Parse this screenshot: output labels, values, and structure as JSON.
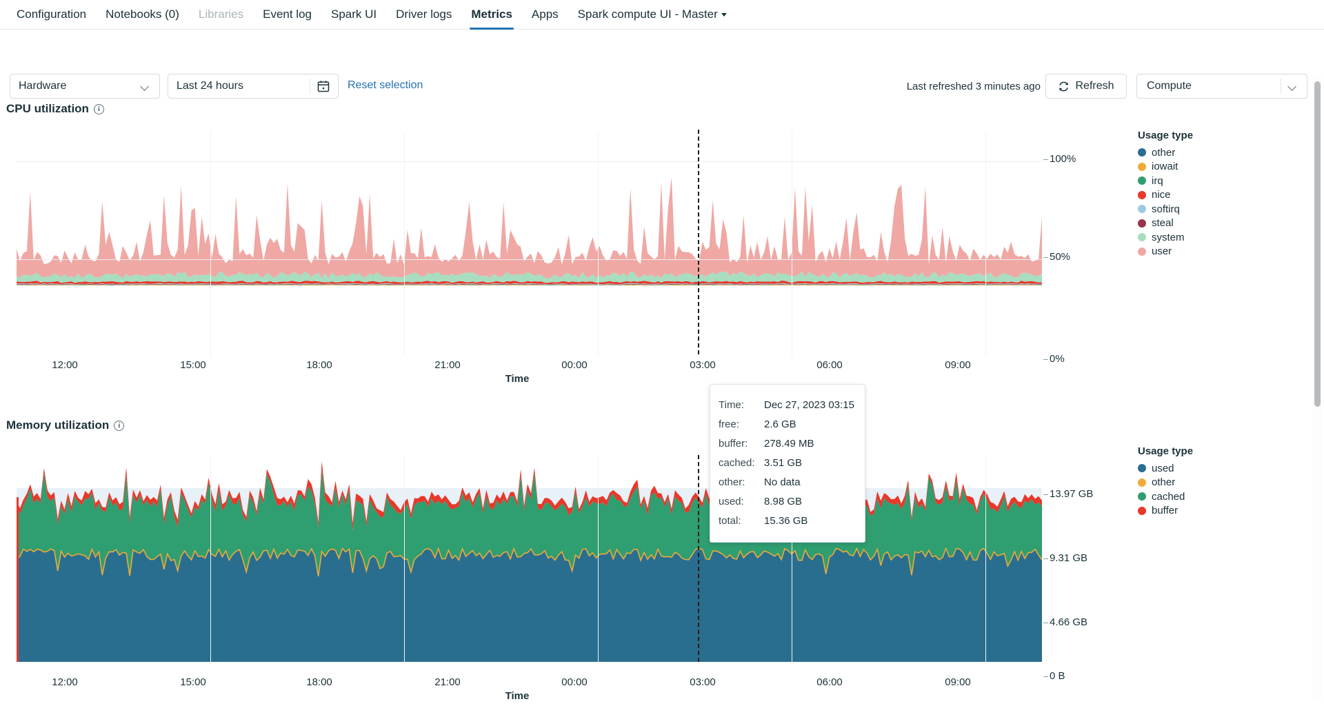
{
  "tabs": [
    {
      "label": "Configuration",
      "state": "normal"
    },
    {
      "label": "Notebooks (0)",
      "state": "normal"
    },
    {
      "label": "Libraries",
      "state": "disabled"
    },
    {
      "label": "Event log",
      "state": "normal"
    },
    {
      "label": "Spark UI",
      "state": "normal"
    },
    {
      "label": "Driver logs",
      "state": "normal"
    },
    {
      "label": "Metrics",
      "state": "active"
    },
    {
      "label": "Apps",
      "state": "normal"
    },
    {
      "label": "Spark compute UI - Master",
      "state": "dropdown"
    }
  ],
  "toolbar": {
    "hardware_select_value": "Hardware",
    "time_range_value": "Last 24 hours",
    "calendar_icon": "calendar-icon",
    "reset_selection_label": "Reset selection",
    "last_refreshed_text": "Last refreshed 3 minutes ago",
    "refresh_label": "Refresh",
    "refresh_icon": "refresh-icon",
    "compute_select_value": "Compute"
  },
  "sections": {
    "cpu": {
      "title": "CPU utilization",
      "info_icon": "info-icon"
    },
    "memory": {
      "title": "Memory utilization",
      "info_icon": "info-icon"
    }
  },
  "tooltip": {
    "rows": [
      {
        "key": "Time:",
        "value": "Dec 27, 2023 03:15"
      },
      {
        "key": "free:",
        "value": "2.6 GB"
      },
      {
        "key": "buffer:",
        "value": "278.49 MB"
      },
      {
        "key": "cached:",
        "value": "3.51 GB"
      },
      {
        "key": "other:",
        "value": "No data"
      },
      {
        "key": "used:",
        "value": "8.98 GB"
      },
      {
        "key": "total:",
        "value": "15.36 GB"
      }
    ]
  },
  "chart_data": [
    {
      "type": "area",
      "id": "cpu-utilization",
      "title": "CPU utilization",
      "xlabel": "Time",
      "ylabel": "",
      "stacked": true,
      "grid": true,
      "legend_position": "right",
      "legend_title": "Usage type",
      "xticks": [
        "12:00",
        "15:00",
        "18:00",
        "21:00",
        "00:00",
        "03:00",
        "06:00",
        "09:00"
      ],
      "yticks": [
        "100%",
        "50%",
        "0%"
      ],
      "ylim": [
        0,
        100
      ],
      "cursor_x_label": "03:15",
      "series": [
        {
          "name": "other",
          "color": "#2a6e8f"
        },
        {
          "name": "iowait",
          "color": "#efab3a"
        },
        {
          "name": "irq",
          "color": "#2f9e70"
        },
        {
          "name": "nice",
          "color": "#e8382a"
        },
        {
          "name": "softirq",
          "color": "#9cc9e4"
        },
        {
          "name": "steal",
          "color": "#96344a"
        },
        {
          "name": "system",
          "color": "#a8ddc0"
        },
        {
          "name": "user",
          "color": "#efa8a4"
        }
      ]
    },
    {
      "type": "area",
      "id": "memory-utilization",
      "title": "Memory utilization",
      "xlabel": "Time",
      "ylabel": "",
      "stacked": true,
      "grid": true,
      "legend_position": "right",
      "legend_title": "Usage type",
      "xticks": [
        "12:00",
        "15:00",
        "18:00",
        "21:00",
        "00:00",
        "03:00",
        "06:00",
        "09:00"
      ],
      "yticks": [
        "13.97 GB",
        "9.31 GB",
        "4.66 GB",
        "0 B"
      ],
      "ylim_bytes": [
        0,
        16493000000
      ],
      "total_label": "15.36 GB",
      "cursor_x_label": "03:15",
      "series": [
        {
          "name": "used",
          "color": "#2a6e8f"
        },
        {
          "name": "other",
          "color": "#efab3a"
        },
        {
          "name": "cached",
          "color": "#2f9e70"
        },
        {
          "name": "buffer",
          "color": "#e8382a"
        }
      ]
    }
  ],
  "colors": {
    "accent": "#2272b4",
    "text": "#1b3139",
    "border": "#d5dbdf",
    "grid": "#eceef0"
  }
}
